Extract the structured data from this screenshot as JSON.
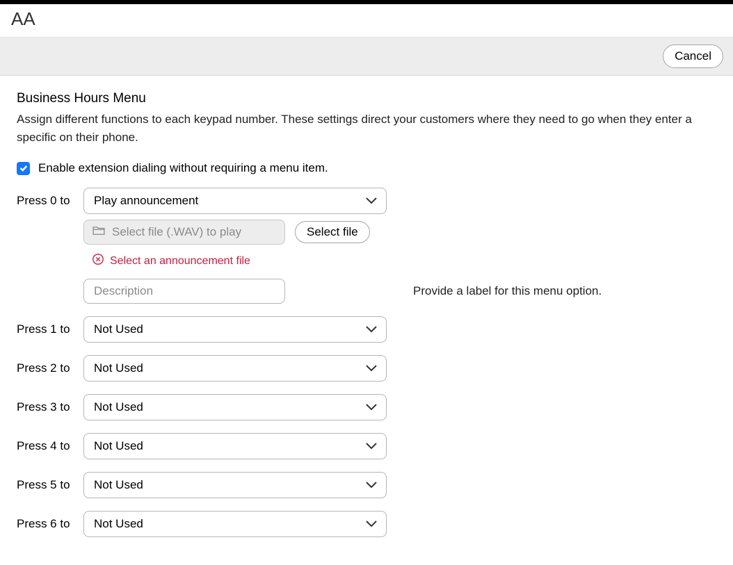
{
  "header": {
    "title": "AA",
    "cancel_label": "Cancel"
  },
  "section": {
    "title": "Business Hours Menu",
    "description": "Assign different functions to each keypad number. These settings direct your customers where they need to go when they enter a specific on their phone."
  },
  "checkbox": {
    "checked": true,
    "label": "Enable extension dialing without requiring a menu item."
  },
  "keypad": {
    "items": [
      {
        "label": "Press 0 to",
        "value": "Play announcement",
        "has_file": true
      },
      {
        "label": "Press 1 to",
        "value": "Not Used",
        "has_file": false
      },
      {
        "label": "Press 2 to",
        "value": "Not Used",
        "has_file": false
      },
      {
        "label": "Press 3 to",
        "value": "Not Used",
        "has_file": false
      },
      {
        "label": "Press 4 to",
        "value": "Not Used",
        "has_file": false
      },
      {
        "label": "Press 5 to",
        "value": "Not Used",
        "has_file": false
      },
      {
        "label": "Press 6 to",
        "value": "Not Used",
        "has_file": false
      }
    ]
  },
  "file_section": {
    "placeholder": "Select file (.WAV) to play",
    "button_label": "Select file",
    "error_text": "Select an announcement file",
    "description_placeholder": "Description",
    "field_hint": "Provide a label for this menu option."
  }
}
